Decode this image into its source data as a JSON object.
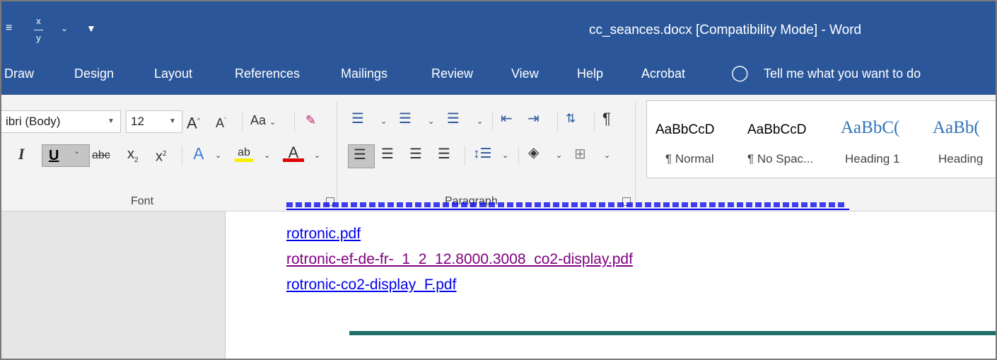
{
  "window": {
    "title": "cc_seances.docx [Compatibility Mode]  -  Word"
  },
  "tabs": [
    {
      "label": "Draw"
    },
    {
      "label": "Design"
    },
    {
      "label": "Layout"
    },
    {
      "label": "References"
    },
    {
      "label": "Mailings"
    },
    {
      "label": "Review"
    },
    {
      "label": "View"
    },
    {
      "label": "Help"
    },
    {
      "label": "Acrobat"
    }
  ],
  "tellme": {
    "label": "Tell me what you want to do"
  },
  "font": {
    "name": "ibri (Body)",
    "size": "12",
    "change_case": "Aa",
    "group_label": "Font",
    "italic": "I",
    "underline": "U",
    "strikethrough": "abc",
    "subscript": "x",
    "superscript": "x"
  },
  "paragraph": {
    "group_label": "Paragraph"
  },
  "styles": [
    {
      "sample": "AaBbCcD",
      "name": "¶ Normal"
    },
    {
      "sample": "AaBbCcD",
      "name": "¶ No Spac..."
    },
    {
      "sample": "AaBbC(",
      "name": "Heading 1"
    },
    {
      "sample": "AaBb(",
      "name": "Heading"
    }
  ],
  "document": {
    "links": [
      {
        "text": "rotronic.pdf",
        "visited": false
      },
      {
        "text": "rotronic-ef-de-fr-_1_2_12.8000.3008_co2-display.pdf",
        "visited": true
      },
      {
        "text": "rotronic-co2-display_F.pdf",
        "visited": false
      }
    ]
  },
  "colors": {
    "title_bar": "#2b579a",
    "link": "#0000ee",
    "visited_link": "#800080",
    "rule": "#1f6f6a"
  }
}
